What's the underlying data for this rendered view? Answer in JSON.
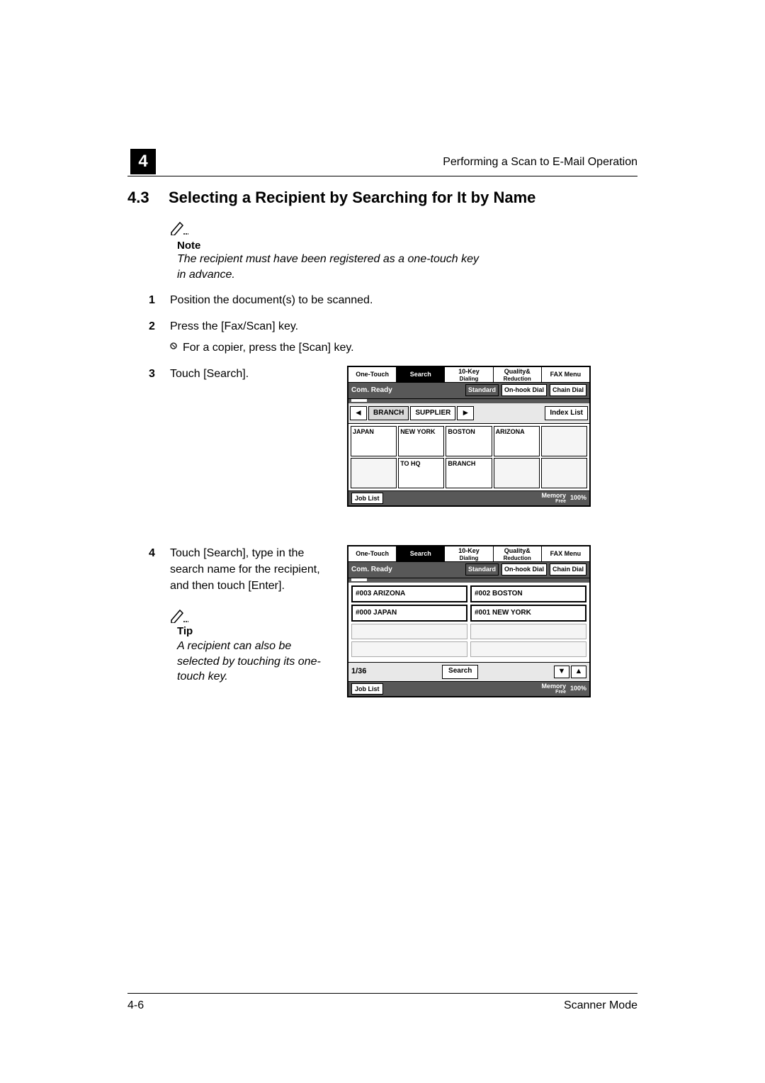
{
  "chapter_badge": "4",
  "running_head": "Performing a Scan to E-Mail Operation",
  "section_number": "4.3",
  "section_title": "Selecting a Recipient by Searching for It by Name",
  "note": {
    "label": "Note",
    "text": "The recipient must have been registered as a one-touch key in advance."
  },
  "steps": {
    "s1": {
      "num": "1",
      "text": "Position the document(s) to be scanned."
    },
    "s2": {
      "num": "2",
      "text": "Press the [Fax/Scan] key.",
      "sub": "For a copier, press the [Scan] key."
    },
    "s3": {
      "num": "3",
      "text": "Touch [Search]."
    },
    "s4": {
      "num": "4",
      "text": "Touch [Search], type in the search name for the recipient, and then touch [Enter]."
    }
  },
  "tip": {
    "label": "Tip",
    "text": "A recipient can also be selected by touching its one-touch key."
  },
  "panel1": {
    "tabs": {
      "one_touch": "One-Touch",
      "search": "Search",
      "tenkey_l1": "10-Key",
      "tenkey_l2": "Dialing",
      "quality_l1": "Quality&",
      "quality_l2": "Reduction",
      "fax_menu": "FAX Menu"
    },
    "status": {
      "com_ready": "Com. Ready",
      "standard": "Standard",
      "onhook": "On-hook Dial",
      "chain": "Chain Dial"
    },
    "index": {
      "left_arrow": "◄",
      "branch": "BRANCH",
      "supplier": "SUPPLIER",
      "right_arrow": "►",
      "index_list": "Index List"
    },
    "cells": {
      "c0": "JAPAN",
      "c1": "NEW YORK",
      "c2": "BOSTON",
      "c3": "ARIZONA",
      "c4": "",
      "c5": "",
      "c6": "TO HQ",
      "c7": "BRANCH",
      "c8": "",
      "c9": ""
    },
    "job": {
      "job_list": "Job List",
      "memory_l1": "Memory",
      "memory_l2": "Free",
      "memory_pct": "100%"
    }
  },
  "panel2": {
    "tabs": {
      "one_touch": "One-Touch",
      "search": "Search",
      "tenkey_l1": "10-Key",
      "tenkey_l2": "Dialing",
      "quality_l1": "Quality&",
      "quality_l2": "Reduction",
      "fax_menu": "FAX Menu"
    },
    "status": {
      "com_ready": "Com. Ready",
      "standard": "Standard",
      "onhook": "On-hook Dial",
      "chain": "Chain Dial"
    },
    "results": {
      "r0": "#003 ARIZONA",
      "r1": "#002 BOSTON",
      "r2": "#000 JAPAN",
      "r3": "#001 NEW YORK"
    },
    "bottom": {
      "count": "1/36",
      "search": "Search",
      "down": "▼",
      "up": "▲"
    },
    "job": {
      "job_list": "Job List",
      "memory_l1": "Memory",
      "memory_l2": "Free",
      "memory_pct": "100%"
    }
  },
  "footer": {
    "left": "4-6",
    "right": "Scanner Mode"
  }
}
